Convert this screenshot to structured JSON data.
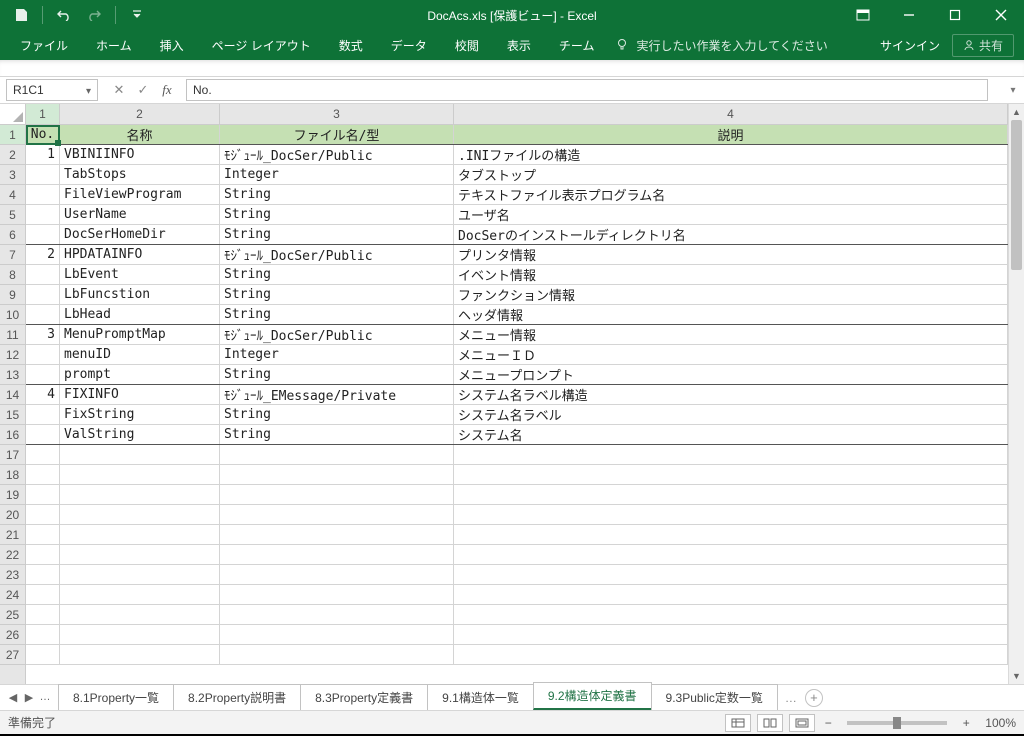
{
  "titlebar": {
    "title": "DocAcs.xls  [保護ビュー] - Excel"
  },
  "ribbon": {
    "file": "ファイル",
    "home": "ホーム",
    "insert": "挿入",
    "layout": "ページ レイアウト",
    "formulas": "数式",
    "data": "データ",
    "review": "校閲",
    "view": "表示",
    "team": "チーム",
    "tellme": "実行したい作業を入力してください",
    "signin": "サインイン",
    "share": "共有"
  },
  "formula_bar": {
    "cell_ref": "R1C1",
    "value": "No."
  },
  "columns": {
    "c1": "1",
    "c2": "2",
    "c3": "3",
    "c4": "4"
  },
  "header_row": {
    "no": "No.",
    "name": "名称",
    "type": "ファイル名/型",
    "desc": "説明"
  },
  "rows": [
    {
      "no": "1",
      "name": "VBINIINFO",
      "type": "ﾓｼﾞｭｰﾙ_DocSer/Public",
      "desc": ".INIファイルの構造",
      "group": false
    },
    {
      "no": "",
      "name": "TabStops",
      "type": "Integer",
      "desc": "タブストップ",
      "group": false
    },
    {
      "no": "",
      "name": "FileViewProgram",
      "type": "String",
      "desc": "テキストファイル表示プログラム名",
      "group": false
    },
    {
      "no": "",
      "name": "UserName",
      "type": "String",
      "desc": "ユーザ名",
      "group": false
    },
    {
      "no": "",
      "name": "DocSerHomeDir",
      "type": "String",
      "desc": "DocSerのインストールディレクトリ名",
      "group": true
    },
    {
      "no": "2",
      "name": "HPDATAINFO",
      "type": "ﾓｼﾞｭｰﾙ_DocSer/Public",
      "desc": "プリンタ情報",
      "group": false
    },
    {
      "no": "",
      "name": "LbEvent",
      "type": "String",
      "desc": "イベント情報",
      "group": false
    },
    {
      "no": "",
      "name": "LbFuncstion",
      "type": "String",
      "desc": "ファンクション情報",
      "group": false
    },
    {
      "no": "",
      "name": "LbHead",
      "type": "String",
      "desc": "ヘッダ情報",
      "group": true
    },
    {
      "no": "3",
      "name": "MenuPromptMap",
      "type": "ﾓｼﾞｭｰﾙ_DocSer/Public",
      "desc": "メニュー情報",
      "group": false
    },
    {
      "no": "",
      "name": "menuID",
      "type": "Integer",
      "desc": "メニューＩＤ",
      "group": false
    },
    {
      "no": "",
      "name": "prompt",
      "type": "String",
      "desc": "メニュープロンプト",
      "group": true
    },
    {
      "no": "4",
      "name": "FIXINFO",
      "type": "ﾓｼﾞｭｰﾙ_EMessage/Private",
      "desc": "システム名ラベル構造",
      "group": false
    },
    {
      "no": "",
      "name": "FixString",
      "type": "String",
      "desc": "システム名ラベル",
      "group": false
    },
    {
      "no": "",
      "name": "ValString",
      "type": "String",
      "desc": "システム名",
      "group": true
    }
  ],
  "empty_row_count": 11,
  "sheet_tabs": {
    "items": [
      {
        "label": "8.1Property一覧",
        "active": false
      },
      {
        "label": "8.2Property説明書",
        "active": false
      },
      {
        "label": "8.3Property定義書",
        "active": false
      },
      {
        "label": "9.1構造体一覧",
        "active": false
      },
      {
        "label": "9.2構造体定義書",
        "active": true
      },
      {
        "label": "9.3Public定数一覧",
        "active": false
      }
    ]
  },
  "statusbar": {
    "ready": "準備完了",
    "zoom": "100%"
  }
}
